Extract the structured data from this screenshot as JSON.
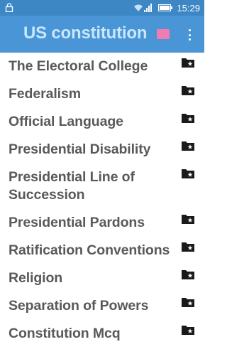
{
  "status": {
    "time": "15:29"
  },
  "app": {
    "title": "US constitution"
  },
  "topics": [
    {
      "label": "The Electoral College"
    },
    {
      "label": "Federalism"
    },
    {
      "label": "Official Language"
    },
    {
      "label": "Presidential Disability"
    },
    {
      "label": "Presidential Line of Succession"
    },
    {
      "label": "Presidential Pardons"
    },
    {
      "label": "Ratification Conventions"
    },
    {
      "label": "Religion"
    },
    {
      "label": "Separation of Powers"
    },
    {
      "label": "Constitution Mcq"
    }
  ],
  "colors": {
    "appbar": "#4a95d6",
    "statusbar": "#3c87c4",
    "title": "#c7e7ff",
    "item_text": "#595959",
    "pink_icon": "#f07cb3"
  },
  "icons": {
    "status_left": "lock-icon",
    "item_trailing": "folder-star-icon",
    "menu": "more-vert-icon"
  }
}
